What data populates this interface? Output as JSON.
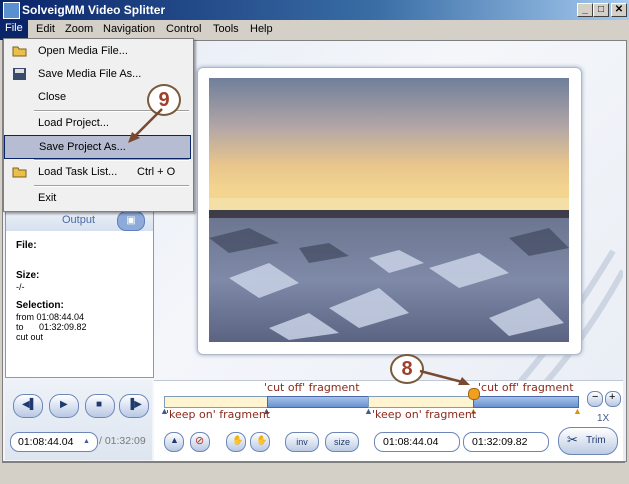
{
  "window": {
    "title": "SolveigMM Video Splitter",
    "minimize": "_",
    "maximize": "□",
    "close": "✕"
  },
  "menubar": [
    "File",
    "Edit",
    "Zoom",
    "Navigation",
    "Control",
    "Tools",
    "Help"
  ],
  "file_menu": {
    "open": "Open Media File...",
    "save_media": "Save Media File As...",
    "close": "Close",
    "load_project": "Load Project...",
    "save_project": "Save Project As...",
    "load_task": "Load Task List...",
    "load_task_shortcut": "Ctrl + O",
    "exit": "Exit"
  },
  "output": {
    "title": "Output",
    "file_label": "File:",
    "size_label": "Size:",
    "size_value": "-/-",
    "selection_label": "Selection:",
    "from": "from 01:08:44.04",
    "to_prefix": "to",
    "to_value": "01:32:09.82",
    "cut": "cut out"
  },
  "annotations": {
    "badge_9": "9",
    "badge_8": "8"
  },
  "timeline": {
    "cut_label_1": "'cut off' fragment",
    "cut_label_2": "'cut off' fragment",
    "keep_label_1": "'keep on' fragment",
    "keep_label_2": "'keep on' fragment",
    "zoom_level": "1X"
  },
  "transport": {
    "current_time": "01:08:44.04",
    "total_time": "/ 01:32:09",
    "inv": "inv",
    "size": "size",
    "marker_in": "01:08:44.04",
    "marker_out": "01:32:09.82",
    "trim": "Trim"
  },
  "colors": {
    "accent": "#0a246a",
    "fragment_text": "#8a2a1a",
    "highlight": "#b6bdd2"
  }
}
